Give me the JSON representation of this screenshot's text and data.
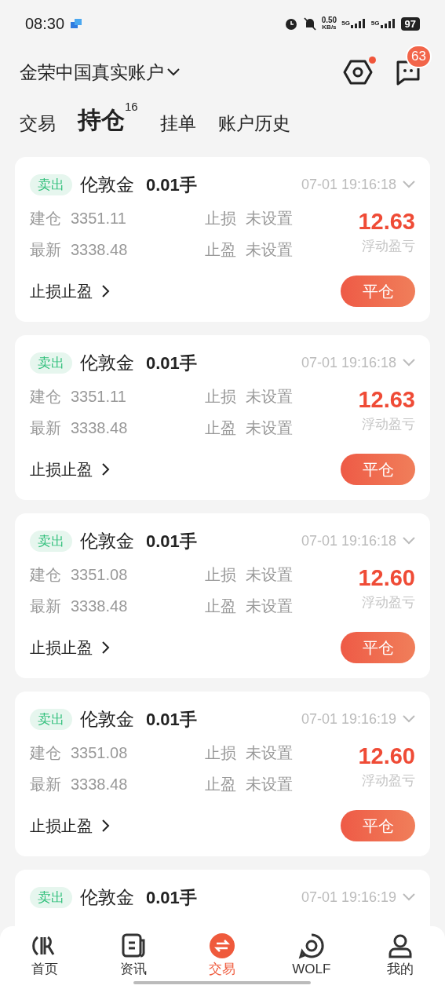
{
  "status_bar": {
    "time": "08:30",
    "net_speed": "0.50",
    "net_unit": "KB/s",
    "network_1": "5G",
    "network_2": "5G",
    "battery": "97"
  },
  "header": {
    "account": "金荣中国真实账户",
    "settings_dot": true,
    "message_badge": "63"
  },
  "tabs": [
    {
      "label": "交易",
      "selected": false
    },
    {
      "label": "持仓",
      "selected": true,
      "count": "16"
    },
    {
      "label": "挂单",
      "selected": false
    },
    {
      "label": "账户历史",
      "selected": false
    }
  ],
  "positions": [
    {
      "side": "卖出",
      "symbol": "伦敦金",
      "lots": "0.01手",
      "time": "07-01 19:16:18",
      "open_label": "建仓",
      "open_price": "3351.11",
      "latest_label": "最新",
      "latest_price": "3338.48",
      "sl_label": "止损",
      "sl_value": "未设置",
      "tp_label": "止盈",
      "tp_value": "未设置",
      "pnl": "12.63",
      "pnl_label": "浮动盈亏",
      "sltp_link": "止损止盈",
      "close_button": "平仓"
    },
    {
      "side": "卖出",
      "symbol": "伦敦金",
      "lots": "0.01手",
      "time": "07-01 19:16:18",
      "open_label": "建仓",
      "open_price": "3351.11",
      "latest_label": "最新",
      "latest_price": "3338.48",
      "sl_label": "止损",
      "sl_value": "未设置",
      "tp_label": "止盈",
      "tp_value": "未设置",
      "pnl": "12.63",
      "pnl_label": "浮动盈亏",
      "sltp_link": "止损止盈",
      "close_button": "平仓"
    },
    {
      "side": "卖出",
      "symbol": "伦敦金",
      "lots": "0.01手",
      "time": "07-01 19:16:18",
      "open_label": "建仓",
      "open_price": "3351.08",
      "latest_label": "最新",
      "latest_price": "3338.48",
      "sl_label": "止损",
      "sl_value": "未设置",
      "tp_label": "止盈",
      "tp_value": "未设置",
      "pnl": "12.60",
      "pnl_label": "浮动盈亏",
      "sltp_link": "止损止盈",
      "close_button": "平仓"
    },
    {
      "side": "卖出",
      "symbol": "伦敦金",
      "lots": "0.01手",
      "time": "07-01 19:16:19",
      "open_label": "建仓",
      "open_price": "3351.08",
      "latest_label": "最新",
      "latest_price": "3338.48",
      "sl_label": "止损",
      "sl_value": "未设置",
      "tp_label": "止盈",
      "tp_value": "未设置",
      "pnl": "12.60",
      "pnl_label": "浮动盈亏",
      "sltp_link": "止损止盈",
      "close_button": "平仓"
    },
    {
      "side": "卖出",
      "symbol": "伦敦金",
      "lots": "0.01手",
      "time": "07-01 19:16:19"
    }
  ],
  "bottom_nav": [
    {
      "label": "首页",
      "selected": false
    },
    {
      "label": "资讯",
      "selected": false
    },
    {
      "label": "交易",
      "selected": true
    },
    {
      "label": "WOLF",
      "selected": false
    },
    {
      "label": "我的",
      "selected": false
    }
  ]
}
